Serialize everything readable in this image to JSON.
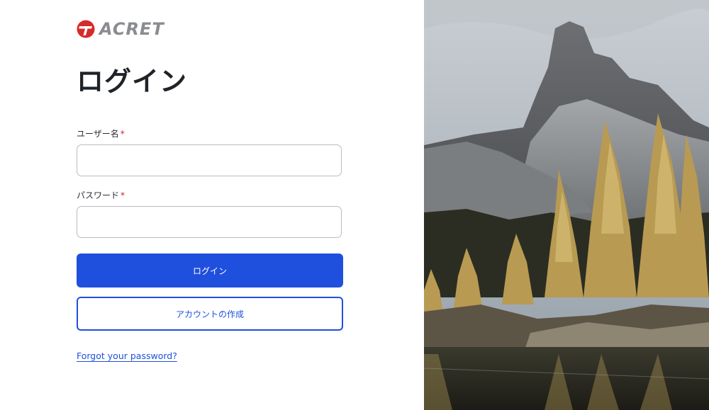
{
  "brand": {
    "name": "ACRET",
    "accent_color": "#d62b2b",
    "text_color": "#8a8c90"
  },
  "login": {
    "title": "ログイン",
    "username_label": "ユーザー名",
    "password_label": "パスワード",
    "required_mark": "*",
    "username_value": "",
    "password_value": "",
    "login_button": "ログイン",
    "create_account_button": "アカウントの作成",
    "forgot_link": "Forgot your password?"
  },
  "colors": {
    "primary": "#1f4fdd",
    "required": "#c62828"
  },
  "hero_image": {
    "subject": "mountain-lake-landscape"
  }
}
